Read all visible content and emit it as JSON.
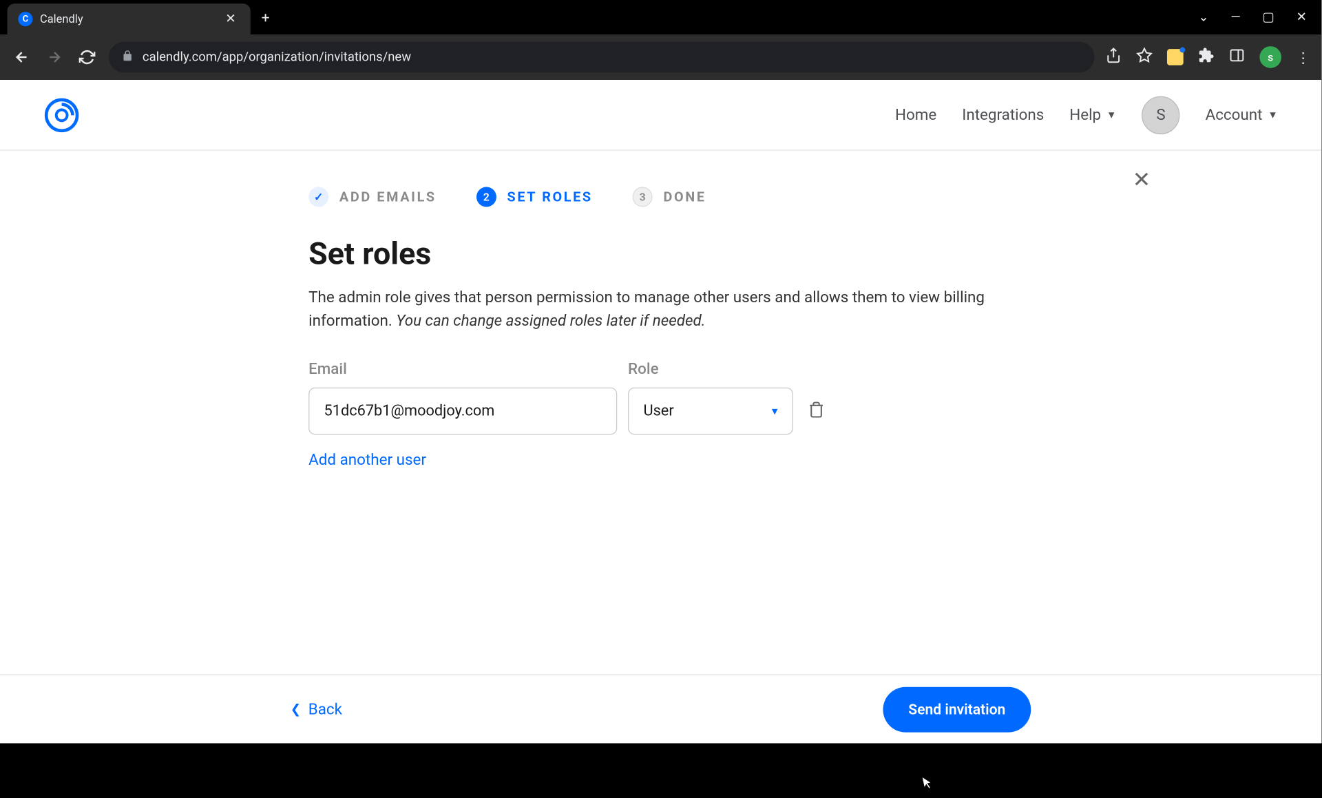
{
  "browser": {
    "tab_title": "Calendly",
    "url": "calendly.com/app/organization/invitations/new",
    "profile_initial": "s"
  },
  "header": {
    "nav": {
      "home": "Home",
      "integrations": "Integrations",
      "help": "Help",
      "account": "Account"
    },
    "avatar_initial": "S"
  },
  "stepper": {
    "step1": {
      "label": "ADD EMAILS",
      "badge": "✓"
    },
    "step2": {
      "label": "SET ROLES",
      "badge": "2"
    },
    "step3": {
      "label": "DONE",
      "badge": "3"
    }
  },
  "page": {
    "title": "Set roles",
    "desc_plain": "The admin role gives that person permission to manage other users and allows them to view billing information. ",
    "desc_italic": "You can change assigned roles later if needed."
  },
  "columns": {
    "email": "Email",
    "role": "Role"
  },
  "rows": [
    {
      "email": "51dc67b1@moodjoy.com",
      "role": "User"
    }
  ],
  "actions": {
    "add_user": "Add another user",
    "back": "Back",
    "send": "Send invitation"
  }
}
